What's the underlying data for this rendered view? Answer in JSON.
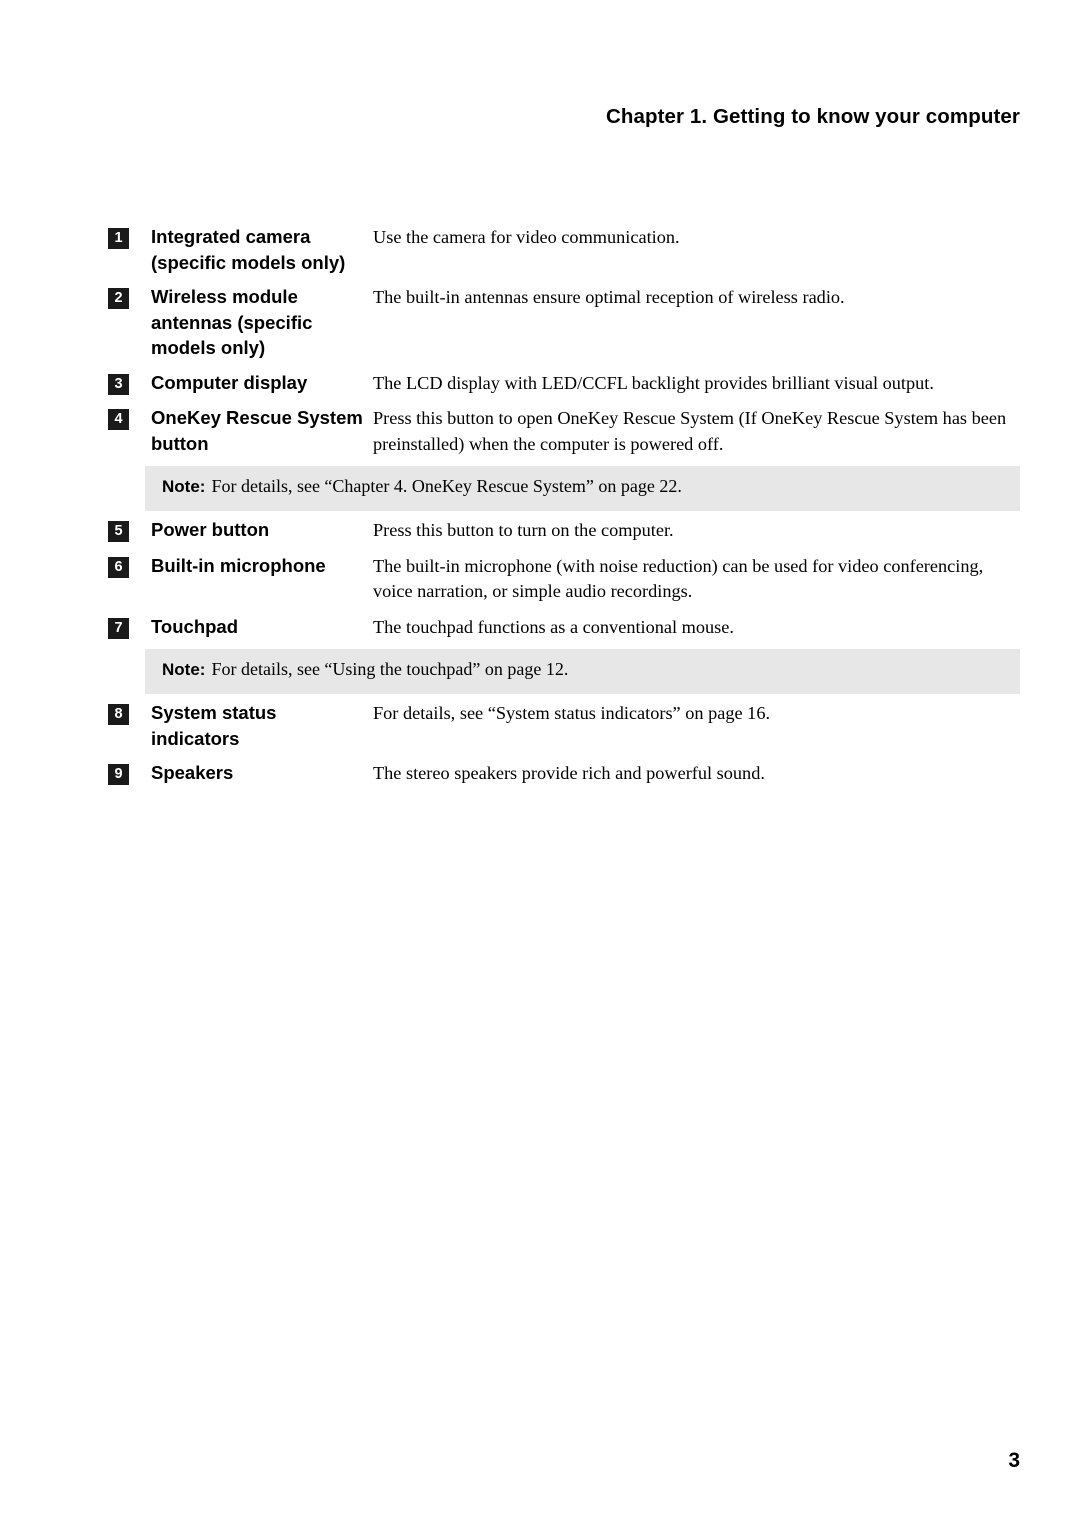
{
  "header": {
    "title": "Chapter 1. Getting to know your computer"
  },
  "table": {
    "rows": [
      {
        "number": "1",
        "label": "Integrated camera (specific models only)",
        "description": "Use the camera for video communication."
      },
      {
        "number": "2",
        "label": "Wireless module antennas (specific models only)",
        "description": "The built-in antennas ensure optimal reception of wireless radio."
      },
      {
        "number": "3",
        "label": "Computer display",
        "description": "The LCD display with LED/CCFL backlight provides brilliant visual output."
      },
      {
        "number": "4",
        "label": "OneKey Rescue System button",
        "description": "Press this button to open OneKey Rescue System (If OneKey Rescue System has been preinstalled) when the computer is powered off."
      },
      {
        "number": "5",
        "label": "Power button",
        "description": "Press this button to turn on the computer."
      },
      {
        "number": "6",
        "label": "Built-in microphone",
        "description": "The built-in microphone (with noise reduction) can be used for video conferencing, voice narration, or simple audio recordings."
      },
      {
        "number": "7",
        "label": "Touchpad",
        "description": "The touchpad functions as a conventional mouse."
      },
      {
        "number": "8",
        "label": "System status indicators",
        "description": "For details, see “System status indicators” on page 16."
      },
      {
        "number": "9",
        "label": "Speakers",
        "description": "The stereo speakers provide rich and powerful sound."
      }
    ]
  },
  "notes": [
    {
      "label": "Note:",
      "text": "For details, see “Chapter 4. OneKey Rescue System” on page 22."
    },
    {
      "label": "Note:",
      "text": "For details, see “Using the touchpad” on page 12."
    }
  ],
  "footer": {
    "page_number": "3"
  }
}
